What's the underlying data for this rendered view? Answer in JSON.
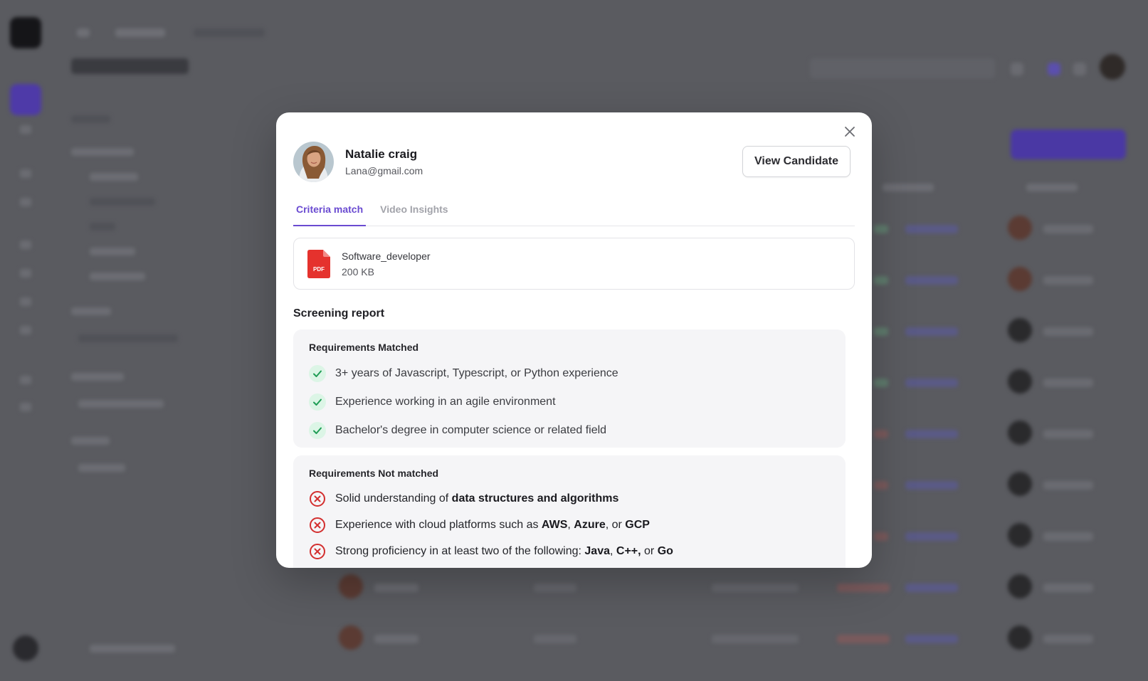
{
  "candidate": {
    "name": "Natalie craig",
    "email": "Lana@gmail.com"
  },
  "actions": {
    "view_candidate_label": "View Candidate"
  },
  "tabs": [
    {
      "label": "Criteria match",
      "active": true
    },
    {
      "label": "Video Insights",
      "active": false
    }
  ],
  "file": {
    "name": "Software_developer",
    "size": "200 KB",
    "badge": "PDF"
  },
  "report": {
    "title": "Screening report",
    "matched": {
      "heading": "Requirements Matched",
      "items": [
        "3+ years of Javascript, Typescript, or Python experience",
        "Experience working in an agile environment",
        "Bachelor's degree in computer science or related field"
      ]
    },
    "not_matched": {
      "heading": "Requirements Not matched",
      "items": [
        [
          {
            "t": "Solid understanding of "
          },
          {
            "t": "data structures and algorithms",
            "b": true
          }
        ],
        [
          {
            "t": "Experience with cloud platforms such as "
          },
          {
            "t": "AWS",
            "b": true
          },
          {
            "t": ", "
          },
          {
            "t": "Azure",
            "b": true
          },
          {
            "t": ", or "
          },
          {
            "t": "GCP",
            "b": true
          }
        ],
        [
          {
            "t": "Strong proficiency in at least two of the following: "
          },
          {
            "t": "Java",
            "b": true
          },
          {
            "t": ", "
          },
          {
            "t": "C++,",
            "b": true
          },
          {
            "t": " or "
          },
          {
            "t": "Go",
            "b": true
          }
        ]
      ]
    }
  },
  "colors": {
    "accent": "#6a4bd1",
    "success": "#1f9d55",
    "success_bg": "#dcf5e6",
    "danger": "#d32f2f",
    "pdf": "#e5322d",
    "overlay": "#5a5b60"
  },
  "icons": [
    "close-icon",
    "pdf-file-icon",
    "check-icon",
    "x-circle-icon"
  ]
}
